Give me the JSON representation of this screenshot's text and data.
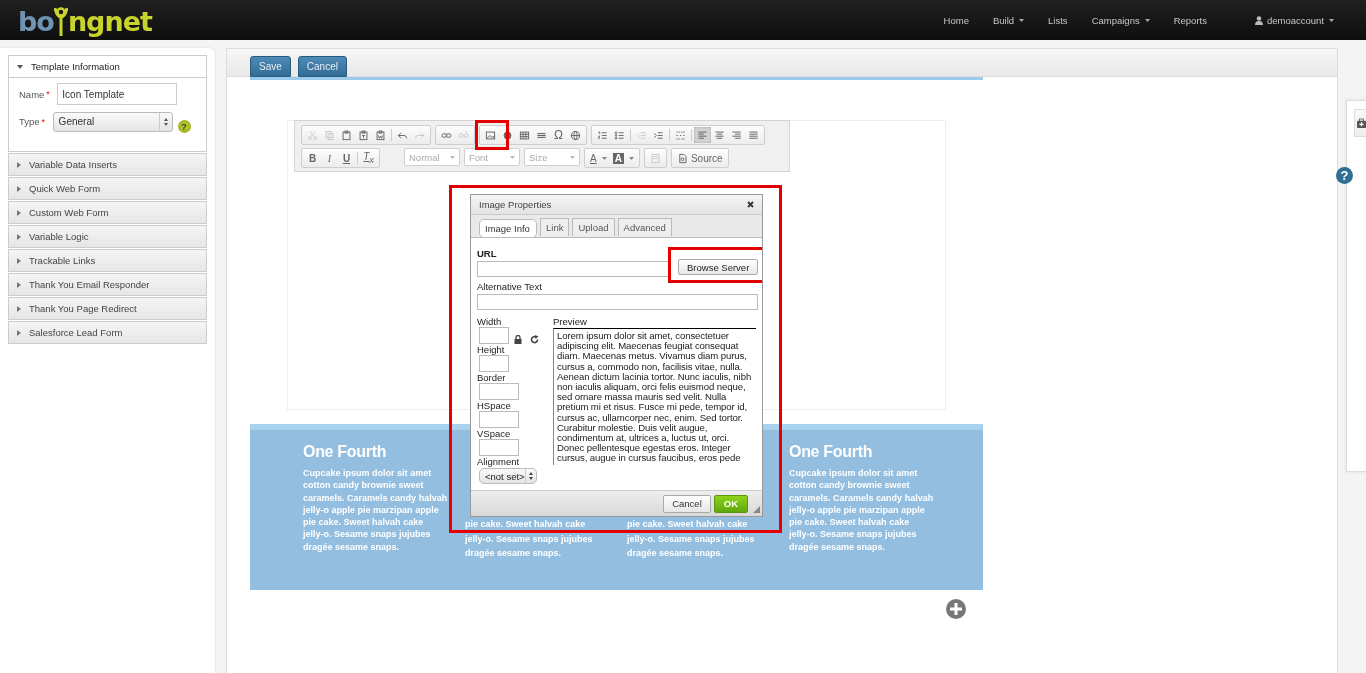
{
  "navbar": {
    "logo": {
      "before": "bo",
      "after": "ngnet"
    },
    "items": [
      {
        "label": "Home",
        "has_menu": false
      },
      {
        "label": "Build",
        "has_menu": true
      },
      {
        "label": "Lists",
        "has_menu": false
      },
      {
        "label": "Campaigns",
        "has_menu": true
      },
      {
        "label": "Reports",
        "has_menu": false
      }
    ],
    "account": {
      "label": "demoaccount",
      "has_menu": true
    }
  },
  "sidebar": {
    "sections": [
      {
        "title": "Template Information",
        "expanded": true,
        "fields": [
          {
            "kind": "text",
            "label": "Name",
            "required_mark": "*",
            "value": "Icon Template"
          },
          {
            "kind": "select",
            "label": "Type",
            "required_mark": "*",
            "value": "General",
            "help": "?"
          }
        ]
      },
      {
        "title": "Variable Data Inserts",
        "expanded": false
      },
      {
        "title": "Quick Web Form",
        "expanded": false
      },
      {
        "title": "Custom Web Form",
        "expanded": false
      },
      {
        "title": "Variable Logic",
        "expanded": false
      },
      {
        "title": "Trackable Links",
        "expanded": false
      },
      {
        "title": "Thank You Email Responder",
        "expanded": false
      },
      {
        "title": "Thank You Page Redirect",
        "expanded": false
      },
      {
        "title": "Salesforce Lead Form",
        "expanded": false
      }
    ]
  },
  "actions": [
    "Save",
    "Cancel"
  ],
  "editor_toolbar": {
    "rows": [
      [
        {
          "segments": [
            [
              {
                "kind": "cut",
                "disabled": true,
                "on": false,
                "highlighted": false
              },
              {
                "kind": "copy",
                "disabled": true,
                "on": false,
                "highlighted": false
              },
              {
                "kind": "paste",
                "disabled": false,
                "on": false,
                "highlighted": false
              },
              {
                "kind": "paste_text",
                "disabled": false,
                "on": false,
                "highlighted": false
              },
              {
                "kind": "paste_word",
                "disabled": false,
                "on": false,
                "highlighted": false
              }
            ],
            [
              {
                "kind": "undo",
                "disabled": false,
                "on": false,
                "highlighted": false
              },
              {
                "kind": "redo",
                "disabled": true,
                "on": false,
                "highlighted": false
              }
            ]
          ]
        },
        {
          "segments": [
            [
              {
                "kind": "link",
                "disabled": false,
                "on": false,
                "highlighted": false
              },
              {
                "kind": "unlink",
                "disabled": true,
                "on": false,
                "highlighted": false
              }
            ]
          ]
        },
        {
          "segments": [
            [
              {
                "kind": "image",
                "disabled": false,
                "on": false,
                "highlighted": true
              },
              {
                "kind": "flash",
                "disabled": false,
                "on": false,
                "highlighted": false
              },
              {
                "kind": "table",
                "disabled": false,
                "on": false,
                "highlighted": false
              },
              {
                "kind": "hrule",
                "disabled": false,
                "on": false,
                "highlighted": false
              },
              {
                "kind": "special_char",
                "text": "Ω",
                "disabled": false,
                "on": false,
                "highlighted": false
              },
              {
                "kind": "iframe",
                "disabled": false,
                "on": false,
                "highlighted": false
              }
            ]
          ]
        },
        {
          "segments": [
            [
              {
                "kind": "numbered_list",
                "disabled": false,
                "on": false,
                "highlighted": false
              },
              {
                "kind": "bulleted_list",
                "disabled": false,
                "on": false,
                "highlighted": false
              }
            ],
            [
              {
                "kind": "outdent",
                "disabled": true,
                "on": false,
                "highlighted": false
              },
              {
                "kind": "indent",
                "disabled": false,
                "on": false,
                "highlighted": false
              }
            ],
            [
              {
                "kind": "blocks",
                "disabled": false,
                "on": false,
                "highlighted": false
              }
            ],
            [
              {
                "kind": "align_left",
                "disabled": false,
                "on": true,
                "highlighted": false
              },
              {
                "kind": "align_center",
                "disabled": false,
                "on": false,
                "highlighted": false
              },
              {
                "kind": "align_right",
                "disabled": false,
                "on": false,
                "highlighted": false
              },
              {
                "kind": "align_justify",
                "disabled": false,
                "on": false,
                "highlighted": false
              }
            ]
          ]
        }
      ],
      [
        {
          "segments": [
            [
              {
                "kind": "bold",
                "text": "B",
                "disabled": false,
                "on": false,
                "highlighted": false
              },
              {
                "kind": "italic",
                "text": "I",
                "disabled": false,
                "on": false,
                "highlighted": false
              },
              {
                "kind": "underline",
                "text": "U",
                "disabled": false,
                "on": false,
                "highlighted": false
              }
            ],
            [
              {
                "kind": "remove_format",
                "text": "T$_{x}$",
                "disabled": false,
                "on": false,
                "highlighted": false
              }
            ]
          ]
        },
        {
          "combo": "Normal"
        },
        {
          "combo": "Font"
        },
        {
          "combo": "Size"
        },
        {
          "segments": [
            [
              {
                "kind": "text_color",
                "text": "A",
                "disabled": false,
                "on": false,
                "highlighted": false
              },
              {
                "kind": "bg_color",
                "text": "A",
                "disabled": false,
                "on": false,
                "highlighted": false
              }
            ]
          ]
        },
        {
          "segments": [
            [
              {
                "kind": "maximize",
                "disabled": true,
                "on": false,
                "highlighted": false
              }
            ]
          ]
        },
        {
          "segments": [
            [
              {
                "kind": "source",
                "text": "Source",
                "disabled": false,
                "on": false,
                "highlighted": false
              }
            ]
          ]
        }
      ]
    ]
  },
  "columns": [
    {
      "heading": "One Fourth",
      "text": "Cupcake ipsum dolor sit amet cotton candy brownie sweet caramels. Caramels candy halvah jelly-o apple pie marzipan apple pie cake. Sweet halvah cake jelly-o. Sesame snaps jujubes dragée sesame snaps."
    },
    {
      "text": "pie cake. Sweet halvah cake jelly-o. Sesame snaps jujubes dragée sesame snaps."
    },
    {
      "text": "pie cake. Sweet halvah cake jelly-o. Sesame snaps jujubes dragée sesame snaps."
    },
    {
      "heading": "One Fourth",
      "text": "Cupcake ipsum dolor sit amet cotton candy brownie sweet caramels. Caramels candy halvah jelly-o apple pie marzipan apple pie cake. Sweet halvah cake jelly-o. Sesame snaps jujubes dragée sesame snaps."
    }
  ],
  "help_icon": "?",
  "dialog": {
    "title": "Image Properties",
    "highlighted": true,
    "tabs": [
      {
        "label": "Image Info",
        "selected": true
      },
      {
        "label": "Link",
        "selected": false
      },
      {
        "label": "Upload",
        "selected": false
      },
      {
        "label": "Advanced",
        "selected": false
      }
    ],
    "url_label": "URL",
    "browse_button": {
      "label": "Browse Server",
      "highlighted": true
    },
    "alt_label": "Alternative Text",
    "size_fields": [
      {
        "kind": "dimension",
        "label": "Width"
      },
      {
        "kind": "dimension",
        "label": "Height"
      },
      {
        "kind": "spacing",
        "label": "Border"
      },
      {
        "kind": "spacing",
        "label": "HSpace"
      },
      {
        "kind": "spacing",
        "label": "VSpace"
      }
    ],
    "alignment": {
      "label": "Alignment",
      "value": "<not set>"
    },
    "preview_label": "Preview",
    "preview_text": "Lorem ipsum dolor sit amet, consectetuer adipiscing elit. Maecenas feugiat consequat diam. Maecenas metus. Vivamus diam purus, cursus a, commodo non, facilisis vitae, nulla. Aenean dictum lacinia tortor. Nunc iaculis, nibh non iaculis aliquam, orci felis euismod neque, sed ornare massa mauris sed velit. Nulla pretium mi et risus. Fusce mi pede, tempor id, cursus ac, ullamcorper nec, enim. Sed tortor. Curabitur molestie. Duis velit augue, condimentum at, ultrices a, luctus ut, orci. Donec pellentesque egestas eros. Integer cursus, augue in cursus faucibus, eros pede",
    "buttons": [
      {
        "kind": "secondary",
        "label": "Cancel"
      },
      {
        "kind": "primary",
        "label": "OK"
      }
    ]
  }
}
